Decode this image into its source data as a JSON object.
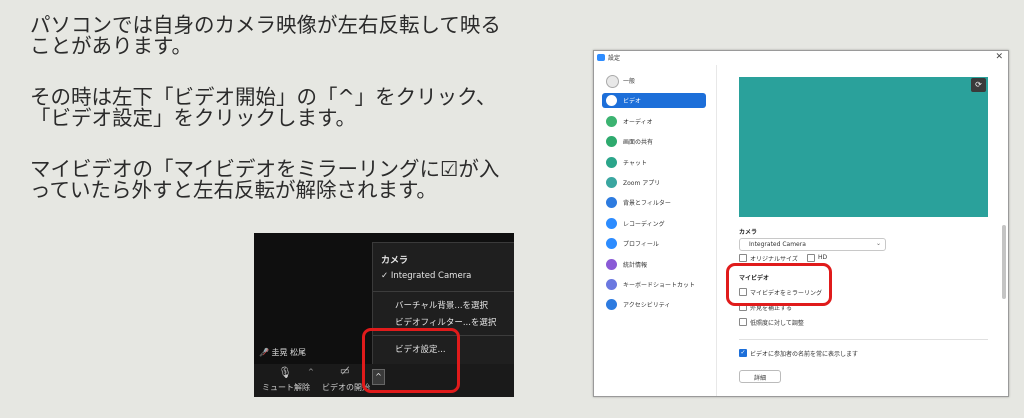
{
  "instructions": {
    "para1": "パソコンでは自身のカメラ映像が左右反転して映ることがあります。",
    "para2": "その時は左下「ビデオ開始」の「^」をクリック、「ビデオ設定」をクリックします。",
    "para3": "マイビデオの「マイビデオをミラーリングに☑が入っていたら外すと左右反転が解除されます。"
  },
  "zoom_menu": {
    "header": "カメラ",
    "selected_camera": "✓ Integrated Camera",
    "virtual_bg": "バーチャル背景...を選択",
    "video_filter": "ビデオフィルター...を選択",
    "video_settings": "ビデオ設定..."
  },
  "zoom_bar": {
    "participant_name": "圭晃 松尾",
    "mute_label": "ミュート解除",
    "video_label": "ビデオの開始",
    "caret": "^"
  },
  "settings": {
    "window_title": "設定",
    "nav": [
      {
        "label": "一般",
        "color": "#e8e8e8"
      },
      {
        "label": "ビデオ",
        "color": "#ffffff"
      },
      {
        "label": "オーディオ",
        "color": "#3cb371"
      },
      {
        "label": "画面の共有",
        "color": "#2eaa6e"
      },
      {
        "label": "チャット",
        "color": "#2ba58a"
      },
      {
        "label": "Zoom アプリ",
        "color": "#3aa6a0"
      },
      {
        "label": "背景とフィルター",
        "color": "#2d7be0"
      },
      {
        "label": "レコーディング",
        "color": "#2d8cff"
      },
      {
        "label": "プロフィール",
        "color": "#2d8cff"
      },
      {
        "label": "統計情報",
        "color": "#8a5ad6"
      },
      {
        "label": "キーボードショートカット",
        "color": "#6b78e0"
      },
      {
        "label": "アクセシビリティ",
        "color": "#2d7be0"
      }
    ],
    "camera_label": "カメラ",
    "camera_value": "Integrated Camera",
    "original_size": "オリジナルサイズ",
    "hd": "HD",
    "my_video_label": "マイビデオ",
    "mirror_label": "マイビデオをミラーリング",
    "touch_up": "外見を補正する",
    "low_light": "低照度に対して調整",
    "show_names": "ビデオに参加者の名前を常に表示します",
    "detail_button": "詳細"
  },
  "colors": {
    "highlight": "#e01b1b",
    "accent": "#1d6fd9",
    "preview": "#2aa19b"
  }
}
